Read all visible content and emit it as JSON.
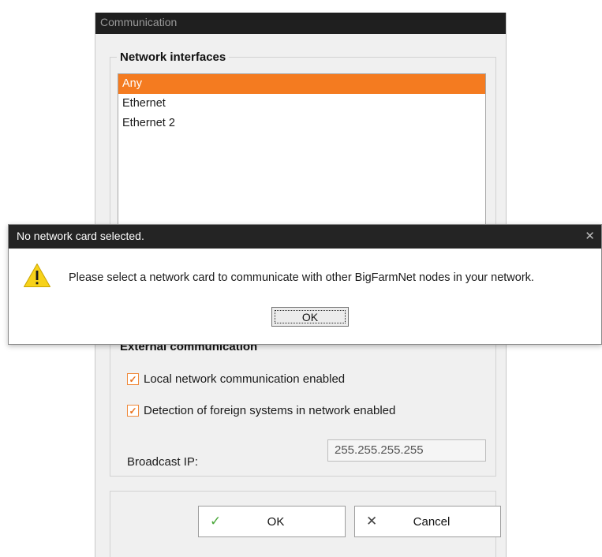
{
  "communication_window": {
    "title": "Communication",
    "network_group": {
      "legend": "Network interfaces",
      "items": [
        {
          "label": "Any",
          "selected": true
        },
        {
          "label": "Ethernet",
          "selected": false
        },
        {
          "label": "Ethernet 2",
          "selected": false
        }
      ]
    },
    "external_group": {
      "legend": "External communication",
      "local_network_checkbox": {
        "label": "Local network communication enabled",
        "checked": true
      },
      "foreign_systems_checkbox": {
        "label": "Detection of foreign systems in network enabled",
        "checked": true
      },
      "broadcast_label": "Broadcast IP:",
      "broadcast_value": "255.255.255.255"
    },
    "buttons": {
      "ok_label": "OK",
      "cancel_label": "Cancel"
    }
  },
  "message_box": {
    "title": "No network card selected.",
    "message": "Please select a network card to communicate with other BigFarmNet nodes in your network.",
    "ok_label": "OK"
  },
  "colors": {
    "selection": "#f47b20",
    "checkbox_accent": "#e8711d",
    "titlebar": "#1f1f1f",
    "warning": "#f7d21a",
    "ok_check": "#4aa83a"
  },
  "icons": {
    "warning": "warning-icon",
    "checkmark": "checkmark-icon",
    "cancel": "x-icon",
    "close": "close-icon"
  }
}
